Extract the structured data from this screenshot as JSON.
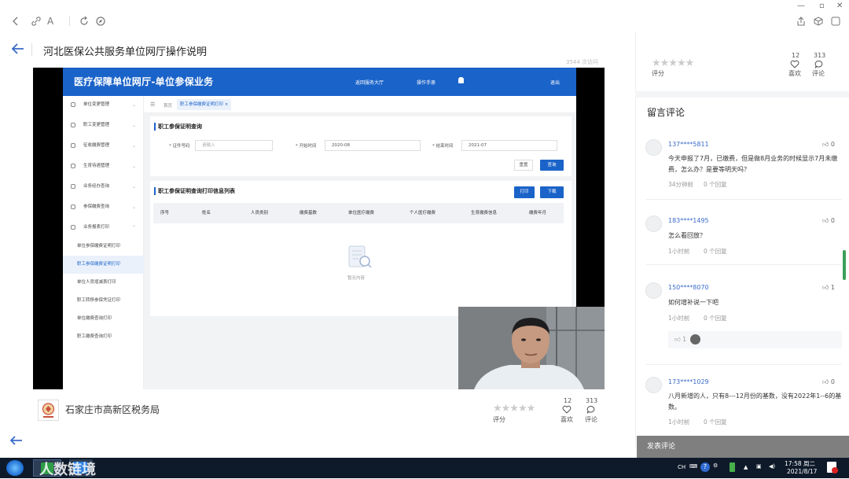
{
  "header": {
    "title": "河北医保公共服务单位网厅操作说明",
    "visits": "3544 次访问"
  },
  "video": {
    "app_title": "医疗保障单位网厅-单位参保业务",
    "top_links": [
      "返回服务大厅",
      "操作手册",
      "退出"
    ],
    "sidebar_items": [
      "单位变更管理",
      "职工变更管理",
      "征收缴费管理",
      "生育待遇管理",
      "业务经办查询",
      "参保缴费查询",
      "业务报表打印"
    ],
    "sidebar_sub": [
      "单位参保缴费证明打印",
      "职工参保缴费证明打印",
      "单位人员增减表打印",
      "职工转移参保凭证打印",
      "单位缴费查询打印",
      "职工缴费查询打印"
    ],
    "breadcrumb_home": "首页",
    "breadcrumb_tab": "职工参保缴费证明打印",
    "query_title": "职工参保证明查询",
    "id_label": "* 证件号码",
    "id_placeholder": "请输入",
    "start_label": "* 开始时间",
    "start_value": "2020-08",
    "end_label": "* 结束时间",
    "end_value": "2021-07",
    "reset": "重置",
    "search": "查询",
    "list_title": "职工参保证明查询打印信息列表",
    "print": "打印",
    "download": "下载",
    "columns": [
      "序号",
      "姓名",
      "人员类别",
      "缴费基数",
      "单位医疗缴费",
      "个人医疗缴费",
      "生育缴费信息",
      "缴费年月"
    ],
    "empty": "暂无内容"
  },
  "below": {
    "org_name": "石家庄市高新区税务局",
    "rate_label": "评分",
    "likes": "12",
    "likes_label": "喜欢",
    "comments_count": "313",
    "comments_label": "评论"
  },
  "right": {
    "rate_label": "评分",
    "likes": "12",
    "likes_label": "喜欢",
    "comments_count": "313",
    "comments_label": "评论",
    "comments_title": "留言评论",
    "comments": [
      {
        "user": "137****5811",
        "text": "今天申报了7月，已缴费，但是做8月业务的时候显示7月未缴费，怎么办？是要等明天吗？",
        "time": "34分钟前",
        "replies": "0 个回复",
        "likes": "0"
      },
      {
        "user": "183****1495",
        "text": "怎么看回放？",
        "time": "1小时前",
        "replies": "0 个回复",
        "likes": "0"
      },
      {
        "user": "150****8070",
        "text": "如何增补说一下吧",
        "time": "1小时前",
        "replies": "0 个回复",
        "likes": "1",
        "sub_likes": "1"
      },
      {
        "user": "173****1029",
        "text": "八月新增的人，只有8---12月份的基数，没有2022年1--6的基数。",
        "time": "1小时前",
        "replies": "0 个回复",
        "likes": "0"
      }
    ],
    "post_comment": "发表评论"
  },
  "taskbar": {
    "watermark": "人数链境",
    "ime": "CH",
    "time": "17:58 周二",
    "date": "2021/8/17"
  },
  "colors": {
    "app_blue": "#1a63c9",
    "link_blue": "#3a6bc9",
    "scroll_green": "#3aa05a"
  }
}
